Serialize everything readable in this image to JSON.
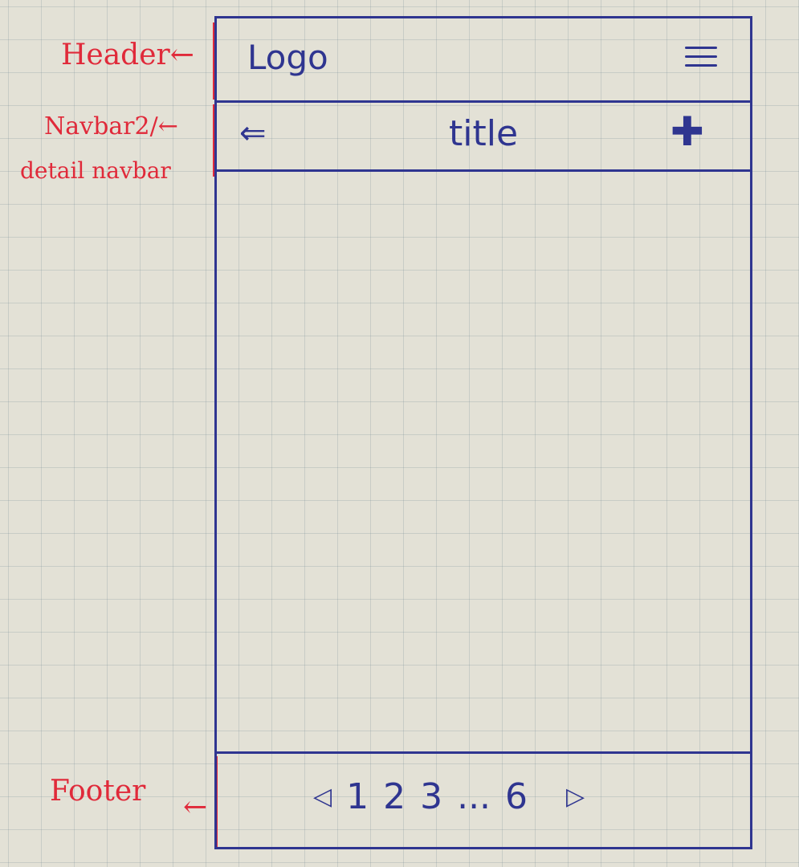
{
  "annotations": {
    "header": "Header",
    "navbar_line1": "Navbar2/",
    "navbar_line2": "detail navbar",
    "footer": "Footer",
    "arrow": "←"
  },
  "header": {
    "logo": "Logo",
    "menu_icon": "hamburger-menu-icon"
  },
  "navbar": {
    "back_icon": "⇐",
    "title": "title",
    "add_icon": "✚"
  },
  "footer": {
    "prev_icon": "◁",
    "pages": [
      "1",
      "2",
      "3",
      "...",
      "6"
    ],
    "next_icon": "▷"
  },
  "colors": {
    "ink": "#2f3590",
    "annotation": "#e02a3a",
    "paper": "#e3e1d6"
  }
}
